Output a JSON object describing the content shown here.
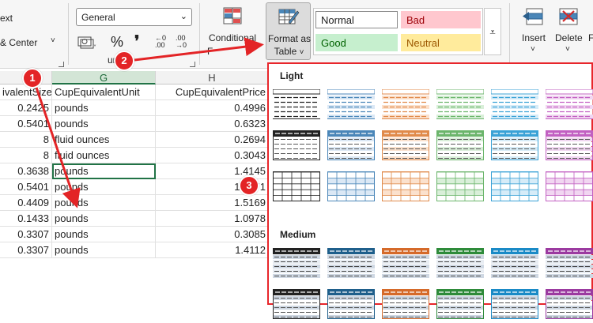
{
  "ribbon": {
    "alignment": {
      "wrap_text_partial": "ext",
      "merge_center_partial": "& Center"
    },
    "number": {
      "format_value": "General",
      "currency_icon": "currency-format-icon",
      "percent": "%",
      "comma": "❜",
      "inc_decimal": "←0 .00",
      "dec_decimal": ".00 →0",
      "group_label_partial": "umber"
    },
    "styles": {
      "conditional_label": "Conditional",
      "conditional_label2_partial": "F",
      "format_table_label": "Format as",
      "format_table_label2": "Table",
      "cell_styles": [
        {
          "label": "Normal",
          "bg": "#ffffff",
          "fg": "#222222",
          "border": "#8a8a8a"
        },
        {
          "label": "Bad",
          "bg": "#ffc7ce",
          "fg": "#9c0006",
          "border": "#ffc7ce"
        },
        {
          "label": "Good",
          "bg": "#c6efce",
          "fg": "#006100",
          "border": "#c6efce"
        },
        {
          "label": "Neutral",
          "bg": "#ffeb9c",
          "fg": "#9c5700",
          "border": "#ffeb9c"
        }
      ]
    },
    "cells": {
      "insert_label": "Insert",
      "delete_label": "Delete",
      "format_label_partial": "F"
    }
  },
  "grid": {
    "columns": [
      {
        "letter": "F",
        "header": "ivalentSize"
      },
      {
        "letter": "G",
        "header": "CupEquivalentUnit"
      },
      {
        "letter": "H",
        "header": "CupEquivalentPrice"
      }
    ],
    "rows": [
      [
        "0.2425",
        "pounds",
        "0.4996"
      ],
      [
        "0.5401",
        "pounds",
        "0.6323"
      ],
      [
        "8",
        "fluid ounces",
        "0.2694"
      ],
      [
        "8",
        "fluid ounces",
        "0.3043"
      ],
      [
        "0.3638",
        "pounds",
        "1.4145"
      ],
      [
        "0.5401",
        "pounds",
        "1.0071"
      ],
      [
        "0.4409",
        "pounds",
        "1.5169"
      ],
      [
        "0.1433",
        "pounds",
        "1.0978"
      ],
      [
        "0.3307",
        "pounds",
        "0.3085"
      ],
      [
        "0.3307",
        "pounds",
        "1.4112"
      ]
    ],
    "selected_row": 4
  },
  "gallery": {
    "light_label": "Light",
    "medium_label": "Medium",
    "light_colors": [
      "#222222",
      "#4a86b8",
      "#e08a4a",
      "#6bb56b",
      "#3aa2d6",
      "#c260c2"
    ],
    "medium_colors": [
      "#222222",
      "#1f5f8b",
      "#d56a2a",
      "#2e8b3a",
      "#1a8ac6",
      "#9b3aa0"
    ],
    "light_fills": [
      "#ffffff",
      "#dbe8f5",
      "#fbe1cd",
      "#d9efd9",
      "#d6ecf8",
      "#f1d6f1"
    ]
  },
  "callouts": [
    "1",
    "2",
    "3"
  ]
}
